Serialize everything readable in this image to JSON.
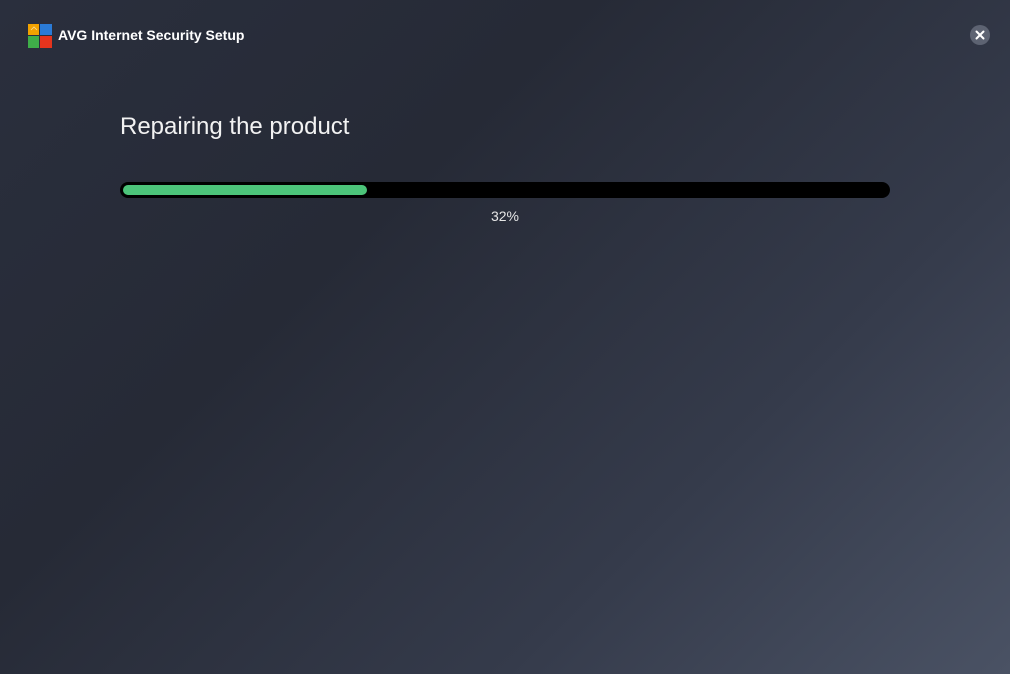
{
  "window": {
    "title": "AVG Internet Security Setup",
    "close_icon": "close-icon",
    "logo_icon": "avg-logo-icon"
  },
  "main": {
    "heading": "Repairing the product",
    "progress": {
      "percent": 32,
      "label": "32%",
      "fill_color": "#4cc47a",
      "track_color": "#000000"
    }
  },
  "colors": {
    "background_start": "#262a36",
    "background_end": "#4a5264",
    "accent": "#4cc47a"
  }
}
